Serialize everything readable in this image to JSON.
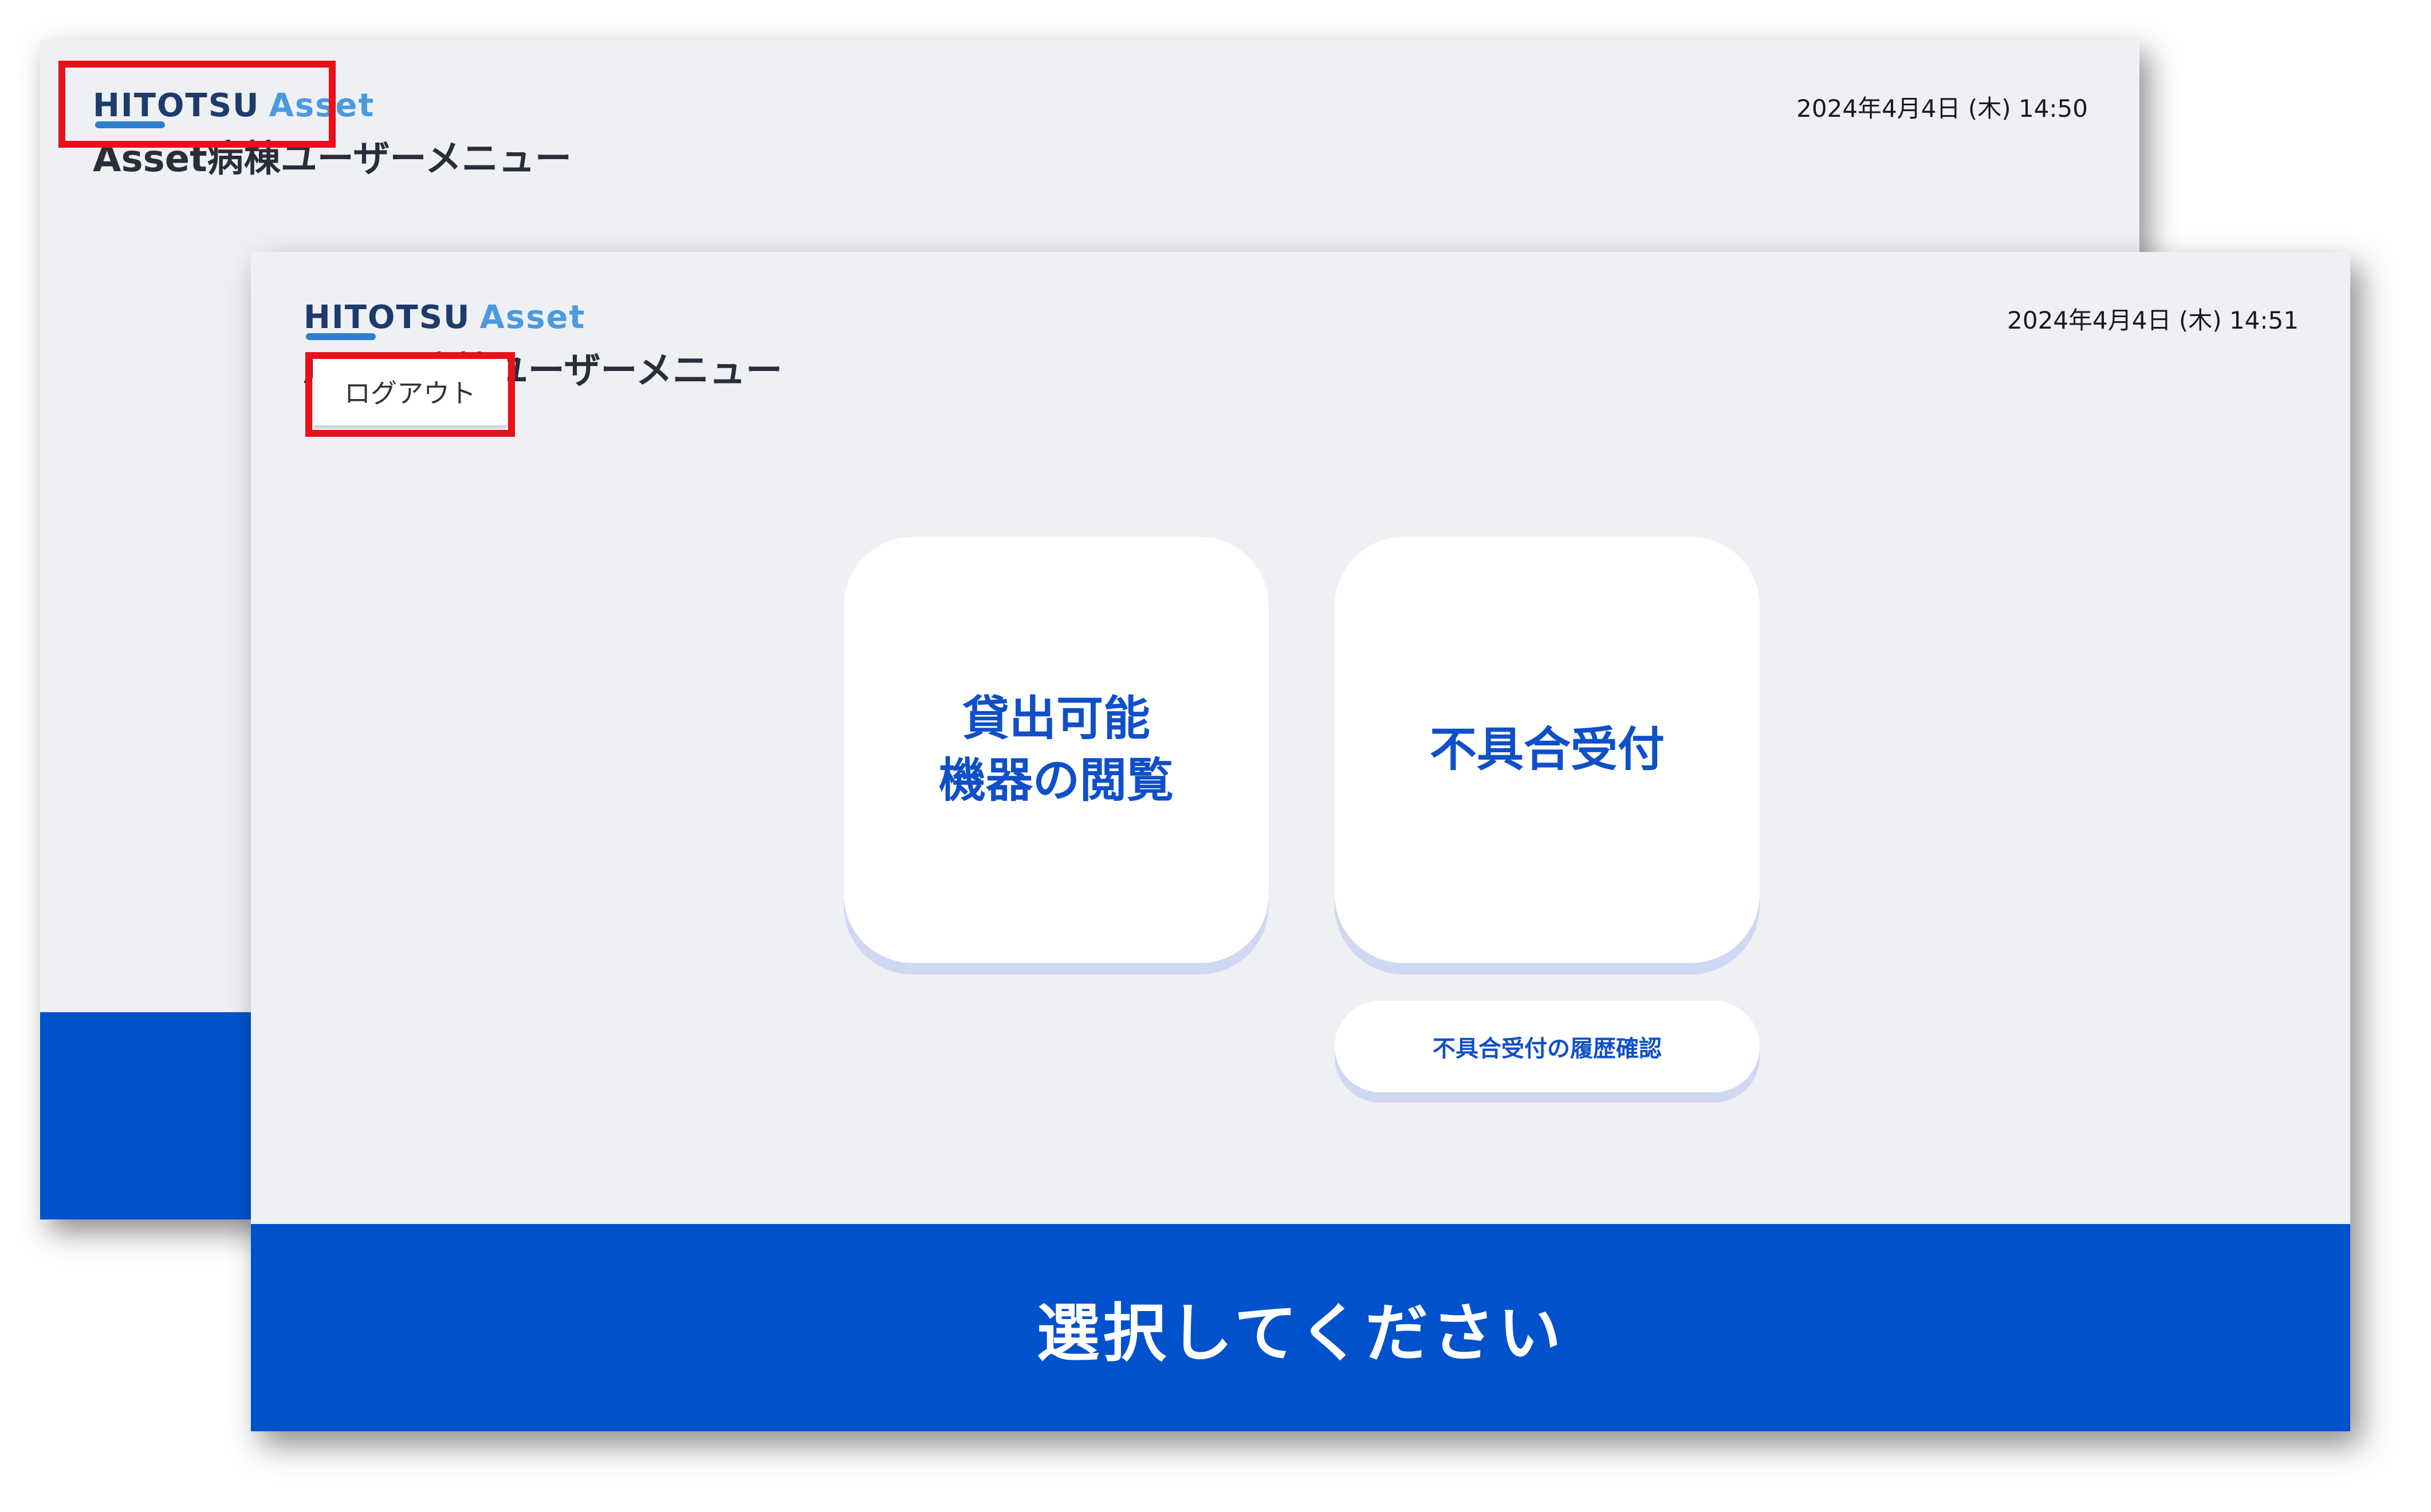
{
  "back_screen": {
    "logo": {
      "brand": "HITOTSU",
      "product": "Asset"
    },
    "title": "Asset病棟ユーザーメニュー",
    "datetime": "2024年4月4日 (木) 14:50"
  },
  "front_screen": {
    "logo": {
      "brand": "HITOTSU",
      "product": "Asset"
    },
    "title": "Asset病棟ユーザーメニュー",
    "datetime": "2024年4月4日 (木) 14:51",
    "logout_label": "ログアウト",
    "cards": {
      "lending_label": "貸出可能\n機器の閲覧",
      "defect_label": "不具合受付"
    },
    "history_label": "不具合受付の履歴確認",
    "footer_text": "選択してください"
  },
  "colors": {
    "background": "#eff0f4",
    "accent": "#0052cc",
    "card_text": "#0f4fc8",
    "highlight": "#e8101a"
  }
}
